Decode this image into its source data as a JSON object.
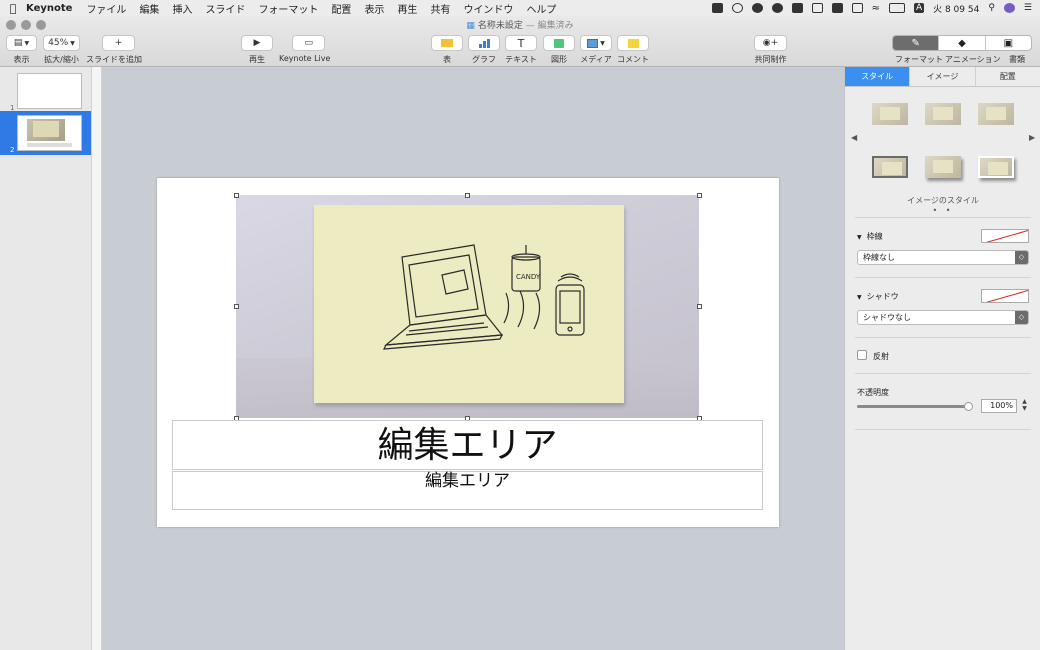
{
  "menubar": {
    "apple": "",
    "app_name": "Keynote",
    "menus": [
      "ファイル",
      "編集",
      "挿入",
      "スライド",
      "フォーマット",
      "配置",
      "表示",
      "再生",
      "共有",
      "ウインドウ",
      "ヘルプ"
    ],
    "status_icons": [
      "dropbox-icon",
      "clipboard-icon",
      "cloud-icon",
      "sync-icon",
      "evernote-icon",
      "contrast-icon",
      "bluetooth-icon",
      "airplay-icon",
      "wifi-icon",
      "battery-icon",
      "input-icon",
      "search-icon",
      "siri-icon",
      "list-icon"
    ],
    "input_source": "A",
    "clock": "火 8 09 54"
  },
  "window": {
    "doc_title": "名称未設定",
    "doc_status": "— 編集済み"
  },
  "toolbar": {
    "view_label": "表示",
    "zoom_value": "45%",
    "zoom_label": "拡大/縮小",
    "add_slide_glyph": "+",
    "add_slide_label": "スライドを追加",
    "play_glyph": "▶",
    "play_label": "再生",
    "keynote_live_label": "Keynote Live",
    "table_label": "表",
    "chart_label": "グラフ",
    "text_glyph": "T",
    "text_label": "テキスト",
    "shape_label": "図形",
    "media_label": "メディア",
    "comment_label": "コメント",
    "collab_label": "共同制作",
    "format_label": "フォーマット",
    "animate_label": "アニメーション",
    "document_label": "書類"
  },
  "navigator": {
    "slides": [
      {
        "number": "1",
        "selected": false
      },
      {
        "number": "2",
        "selected": true
      }
    ]
  },
  "slide": {
    "title": "編集エリア",
    "subtitle": "編集エリア"
  },
  "inspector": {
    "tabs": [
      "スタイル",
      "イメージ",
      "配置"
    ],
    "active_tab": "スタイル",
    "image_styles_label": "イメージのスタイル",
    "page_dots": "• •",
    "border_label": "枠線",
    "border_value": "枠線なし",
    "shadow_label": "シャドウ",
    "shadow_value": "シャドウなし",
    "reflection_label": "反射",
    "opacity_label": "不透明度",
    "opacity_value": "100%",
    "opacity_fraction": 1.0,
    "disclosure_glyph": "▼",
    "chevron_glyph": "◇"
  },
  "colors": {
    "accent_blue": "#3a8ff0",
    "selection_blue": "#2f7ae5",
    "no_color_red": "#e02020"
  }
}
